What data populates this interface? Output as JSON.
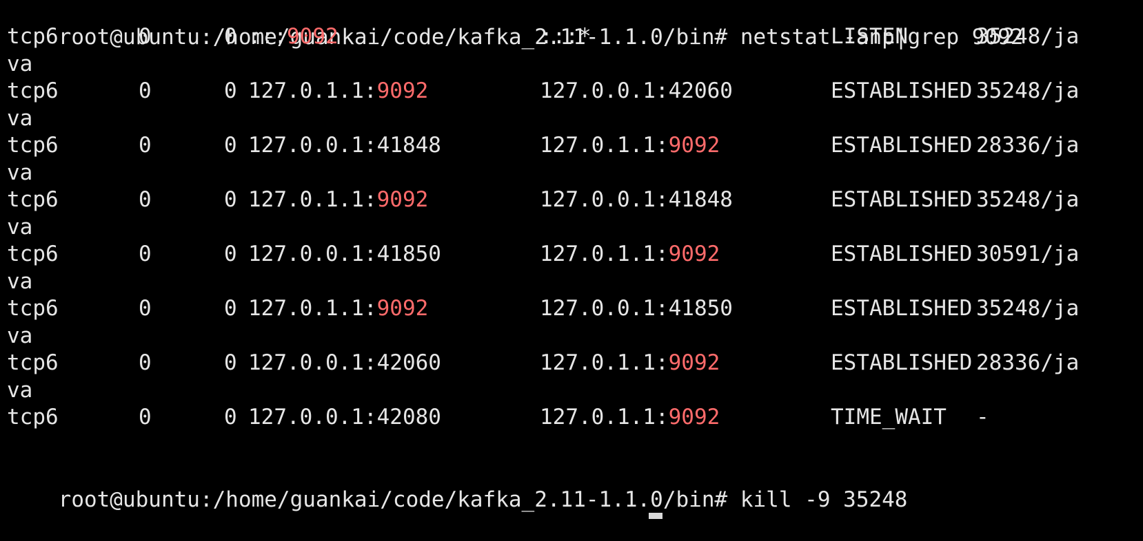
{
  "terminal": {
    "colors": {
      "background": "#000000",
      "foreground": "#e6e6e6",
      "highlight": "#ff6b6b"
    },
    "command1": {
      "prompt": "root@ubuntu:/home/guankai/code/kafka_2.11-1.1.0/bin#",
      "command": "netstat -anp|grep 9092"
    },
    "highlight_term": "9092",
    "rows": [
      {
        "proto": "tcp6",
        "recv_q": "0",
        "send_q": "0",
        "local_address": ":::9092",
        "foreign_address": ":::*",
        "state": "LISTEN",
        "pid_program": "35248/ja",
        "pid_program_wrap": "va"
      },
      {
        "proto": "tcp6",
        "recv_q": "0",
        "send_q": "0",
        "local_address": "127.0.1.1:9092",
        "foreign_address": "127.0.0.1:42060",
        "state": "ESTABLISHED",
        "pid_program": "35248/ja",
        "pid_program_wrap": "va"
      },
      {
        "proto": "tcp6",
        "recv_q": "0",
        "send_q": "0",
        "local_address": "127.0.0.1:41848",
        "foreign_address": "127.0.1.1:9092",
        "state": "ESTABLISHED",
        "pid_program": "28336/ja",
        "pid_program_wrap": "va"
      },
      {
        "proto": "tcp6",
        "recv_q": "0",
        "send_q": "0",
        "local_address": "127.0.1.1:9092",
        "foreign_address": "127.0.0.1:41848",
        "state": "ESTABLISHED",
        "pid_program": "35248/ja",
        "pid_program_wrap": "va"
      },
      {
        "proto": "tcp6",
        "recv_q": "0",
        "send_q": "0",
        "local_address": "127.0.0.1:41850",
        "foreign_address": "127.0.1.1:9092",
        "state": "ESTABLISHED",
        "pid_program": "30591/ja",
        "pid_program_wrap": "va"
      },
      {
        "proto": "tcp6",
        "recv_q": "0",
        "send_q": "0",
        "local_address": "127.0.1.1:9092",
        "foreign_address": "127.0.0.1:41850",
        "state": "ESTABLISHED",
        "pid_program": "35248/ja",
        "pid_program_wrap": "va"
      },
      {
        "proto": "tcp6",
        "recv_q": "0",
        "send_q": "0",
        "local_address": "127.0.0.1:42060",
        "foreign_address": "127.0.1.1:9092",
        "state": "ESTABLISHED",
        "pid_program": "28336/ja",
        "pid_program_wrap": "va"
      },
      {
        "proto": "tcp6",
        "recv_q": "0",
        "send_q": "0",
        "local_address": "127.0.0.1:42080",
        "foreign_address": "127.0.1.1:9092",
        "state": "TIME_WAIT",
        "pid_program": "-",
        "pid_program_wrap": ""
      }
    ],
    "command2": {
      "prompt": "root@ubuntu:/home/guankai/code/kafka_2.11-1.1.0/bin#",
      "command": "kill -9 35248"
    }
  }
}
